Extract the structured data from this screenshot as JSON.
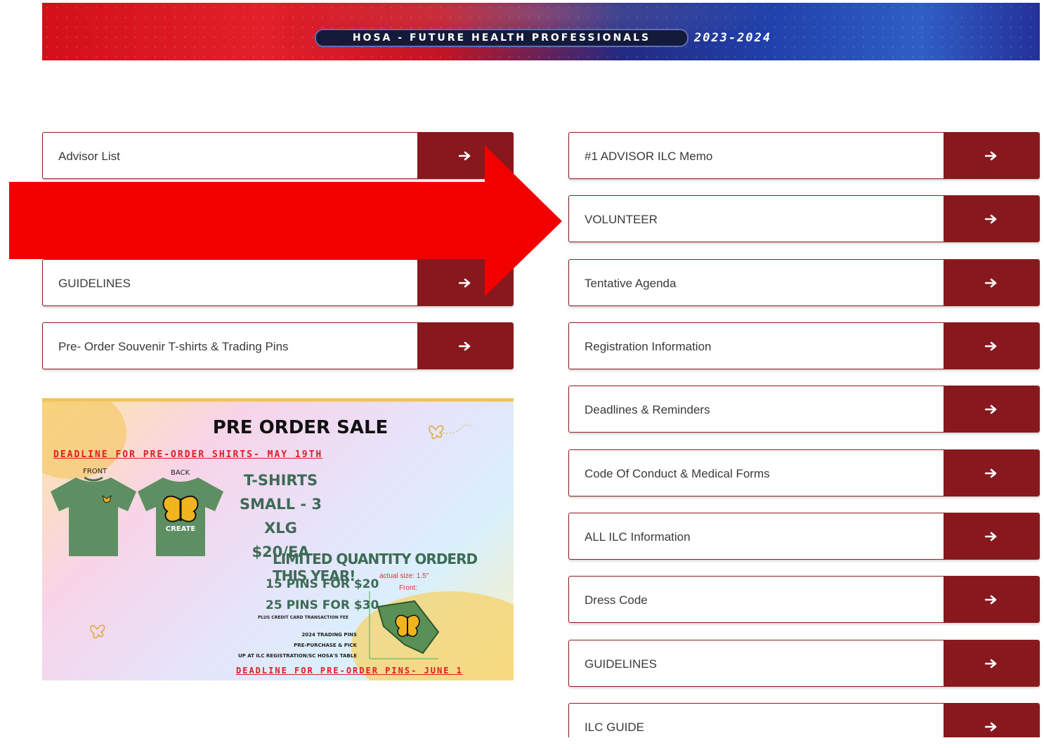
{
  "banner": {
    "org": "HOSA - FUTURE HEALTH PROFESSIONALS",
    "year": "2023-2024"
  },
  "left_links": [
    {
      "label": "Advisor List"
    },
    {
      "label": "GUIDELINES"
    },
    {
      "label": "Pre- Order Souvenir T-shirts & Trading Pins"
    }
  ],
  "right_links": [
    {
      "label": "#1 ADVISOR ILC Memo"
    },
    {
      "label": "VOLUNTEER"
    },
    {
      "label": "Tentative Agenda"
    },
    {
      "label": "Registration Information"
    },
    {
      "label": "Deadlines & Reminders"
    },
    {
      "label": "Code Of Conduct & Medical Forms"
    },
    {
      "label": "ALL ILC Information"
    },
    {
      "label": "Dress Code"
    },
    {
      "label": "GUIDELINES"
    },
    {
      "label": "ILC GUIDE"
    }
  ],
  "link_arrow_icon": "arrow-right-icon",
  "promo": {
    "title": "PRE ORDER SALE",
    "deadline_shirts": "DEADLINE FOR PRE-ORDER SHIRTS- MAY 19TH",
    "front_label": "FRONT",
    "back_label": "BACK",
    "tshirts": "T-SHIRTS",
    "sizes": "SMALL - 3 XLG",
    "price": "$20/EA",
    "limited": "LIMITED QUANTITY ORDERD THIS YEAR!",
    "pins_15": "15 PINS FOR $20",
    "pins_25": "25 PINS FOR $30",
    "fee": "PLUS CREDIT CARD TRANSACTION FEE",
    "trading_1": "2024 TRADING PINS",
    "trading_2": "PRE-PURCHASE & PICK",
    "trading_3": "UP AT ILC REGISTRATION/SC HOSA'S TABLE",
    "actual_size": "actual size: 1.5\"",
    "front_pin": "Front:",
    "deadline_pins": "DEADLINE FOR PRE-ORDER PINS- JUNE 1"
  },
  "colors": {
    "button_accent": "#87181d",
    "overlay_arrow": "#f20000",
    "promo_red": "#e01b24",
    "promo_green": "#3d6b55"
  }
}
